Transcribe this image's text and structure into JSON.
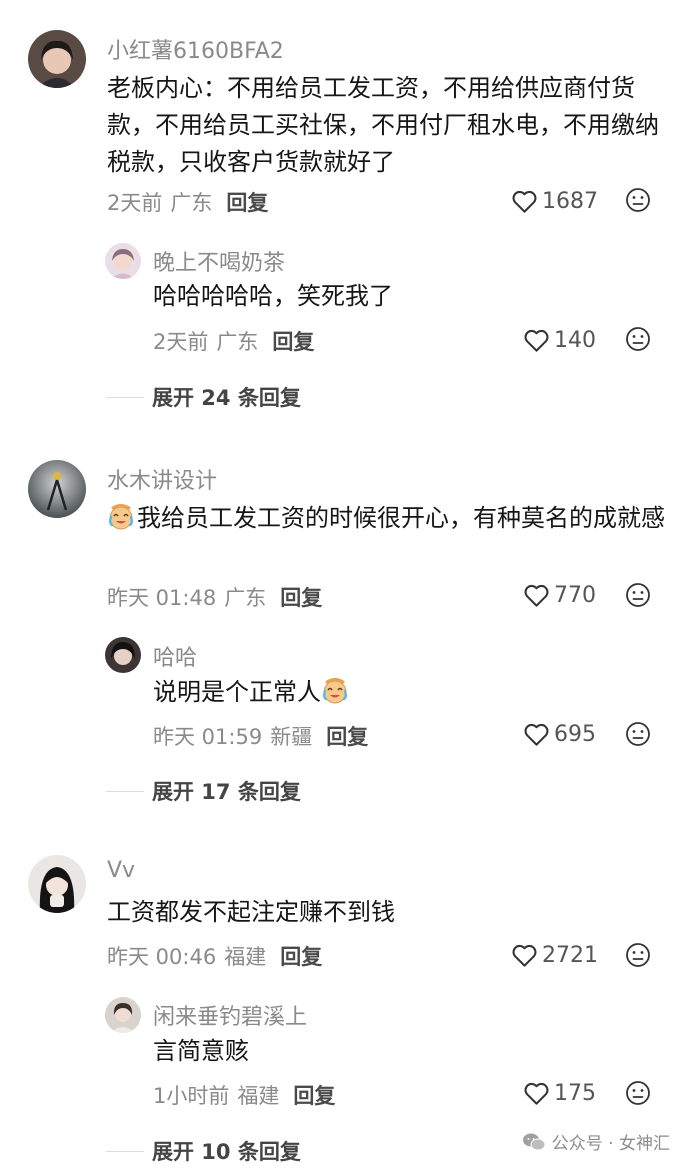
{
  "comments": [
    {
      "username": "小红薯6160BFA2",
      "text": "老板内心：不用给员工发工资，不用给供应商付货款，不用给员工买社保，不用付厂租水电，不用缴纳税款，只收客户货款就好了",
      "time": "2天前",
      "location": "广东",
      "reply_label": "回复",
      "likes": "1687",
      "replies": [
        {
          "username": "晚上不喝奶茶",
          "text": "哈哈哈哈哈，笑死我了",
          "time": "2天前",
          "location": "广东",
          "reply_label": "回复",
          "likes": "140"
        }
      ],
      "expand_label": "展开 24 条回复"
    },
    {
      "username": "水木讲设计",
      "text": "我给员工发工资的时候很开心，有种莫名的成就感",
      "text_emoji": "crying-laughing-emoji",
      "time": "昨天 01:48",
      "location": "广东",
      "reply_label": "回复",
      "likes": "770",
      "replies": [
        {
          "username": "哈哈",
          "text": "说明是个正常人",
          "text_emoji": "crying-laughing-emoji",
          "time": "昨天 01:59",
          "location": "新疆",
          "reply_label": "回复",
          "likes": "695"
        }
      ],
      "expand_label": "展开 17 条回复"
    },
    {
      "username": "Vv",
      "text": "工资都发不起注定赚不到钱",
      "time": "昨天 00:46",
      "location": "福建",
      "reply_label": "回复",
      "likes": "2721",
      "replies": [
        {
          "username": "闲来垂钓碧溪上",
          "text": "言简意赅",
          "time": "1小时前",
          "location": "福建",
          "reply_label": "回复",
          "likes": "175"
        }
      ],
      "expand_label": "展开 10 条回复"
    }
  ],
  "watermark": "公众号 · 女神汇",
  "colors": {
    "username": "#8a8a8a",
    "text": "#161616",
    "meta": "#8a8a8a"
  }
}
